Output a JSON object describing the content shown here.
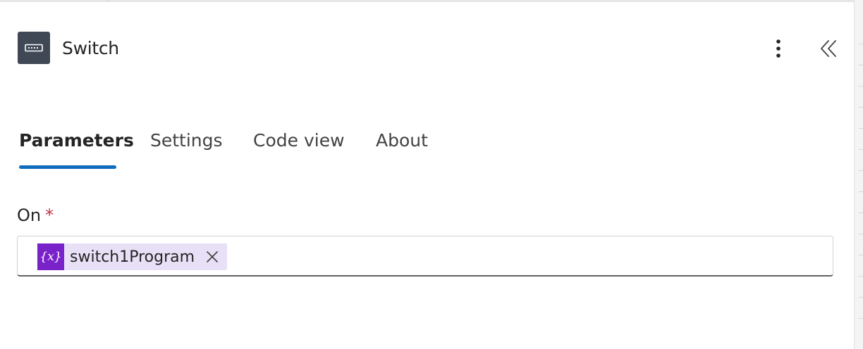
{
  "header": {
    "title": "Switch",
    "icon": "switch-action-icon",
    "more_icon": "more-vertical-icon",
    "collapse_icon": "double-chevron-left-icon"
  },
  "tabs": [
    {
      "label": "Parameters",
      "active": true
    },
    {
      "label": "Settings",
      "active": false
    },
    {
      "label": "Code view",
      "active": false
    },
    {
      "label": "About",
      "active": false
    }
  ],
  "parameters": {
    "on_field": {
      "label": "On",
      "required_marker": "*",
      "token": {
        "icon_text": "{x}",
        "value": "switch1Program",
        "remove_icon": "close-icon"
      }
    }
  },
  "colors": {
    "accent": "#0f6cbd",
    "header_icon_bg": "#3f4854",
    "token_icon_bg": "#7a22c9",
    "token_bg": "#e8e0f6",
    "required": "#c4314b"
  }
}
